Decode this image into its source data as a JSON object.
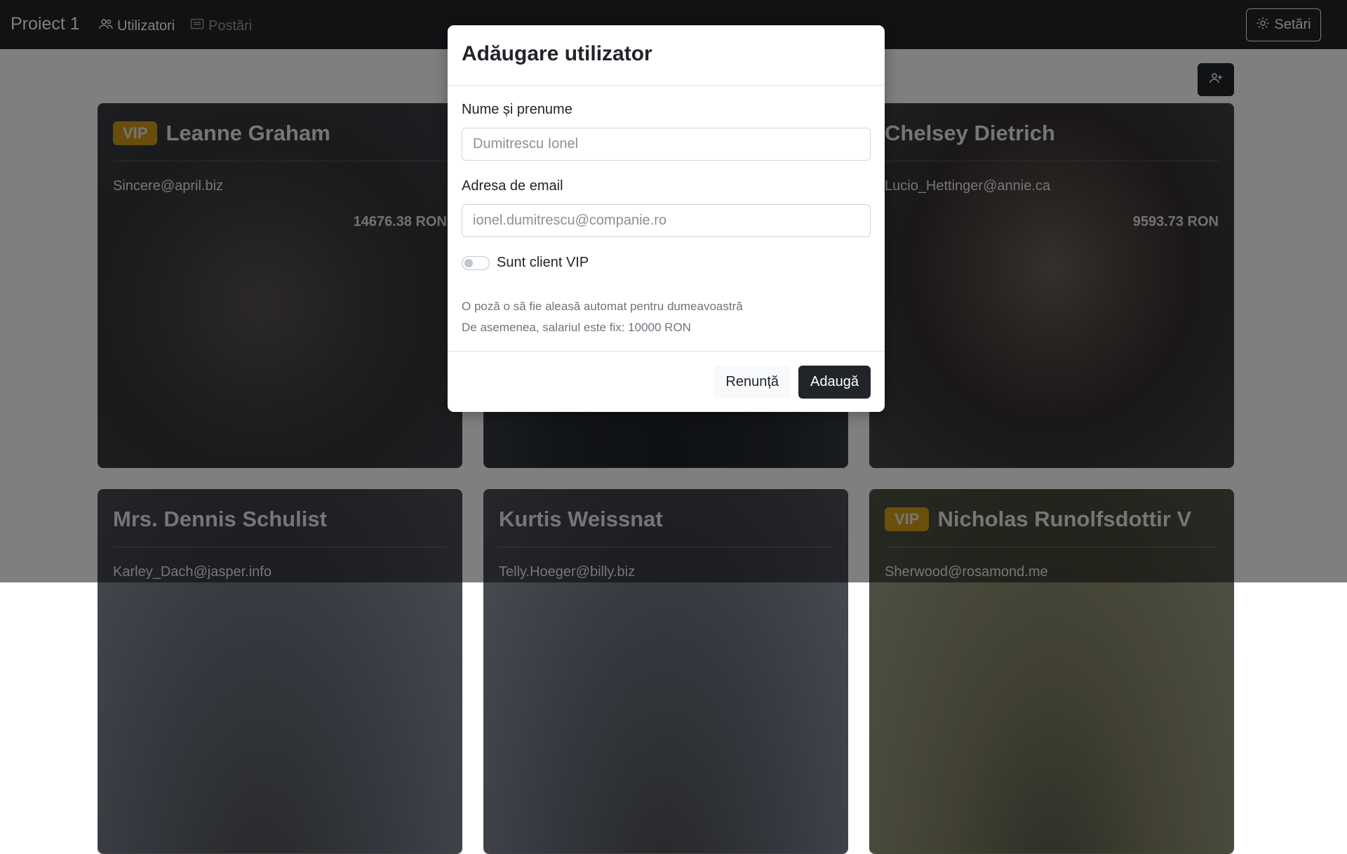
{
  "navbar": {
    "brand": "Proiect 1",
    "links": [
      {
        "label": "Utilizatori",
        "icon": "users-icon",
        "active": true
      },
      {
        "label": "Postări",
        "icon": "card-text-icon",
        "active": false
      }
    ],
    "settings_label": "Setări"
  },
  "toolbar": {
    "add_user_icon": "person-plus-icon"
  },
  "cards": [
    {
      "vip": true,
      "vip_label": "VIP",
      "name": "Leanne Graham",
      "email": "Sincere@april.biz",
      "salary": "14676.38 RON"
    },
    {
      "vip": false,
      "vip_label": "",
      "name": "",
      "email": "",
      "salary": ""
    },
    {
      "vip": false,
      "vip_label": "",
      "name": "Chelsey Dietrich",
      "email": "Lucio_Hettinger@annie.ca",
      "salary": "9593.73 RON"
    },
    {
      "vip": false,
      "vip_label": "",
      "name": "Mrs. Dennis Schulist",
      "email": "Karley_Dach@jasper.info",
      "salary": ""
    },
    {
      "vip": false,
      "vip_label": "",
      "name": "Kurtis Weissnat",
      "email": "Telly.Hoeger@billy.biz",
      "salary": ""
    },
    {
      "vip": true,
      "vip_label": "VIP",
      "name": "Nicholas Runolfsdottir V",
      "email": "Sherwood@rosamond.me",
      "salary": ""
    }
  ],
  "modal": {
    "title": "Adăugare utilizator",
    "name_label": "Nume și prenume",
    "name_placeholder": "Dumitrescu Ionel",
    "email_label": "Adresa de email",
    "email_placeholder": "ionel.dumitrescu@companie.ro",
    "vip_switch_label": "Sunt client VIP",
    "vip_switch_checked": false,
    "info_line1": "O poză o să fie aleasă automat pentru dumeavoastră",
    "info_line2": "De asemenea, salariul este fix: 10000 RON",
    "cancel_label": "Renunță",
    "add_label": "Adaugă"
  },
  "colors": {
    "navbar_bg": "#212529",
    "vip_badge": "#e4a812",
    "primary_button": "#212529"
  }
}
